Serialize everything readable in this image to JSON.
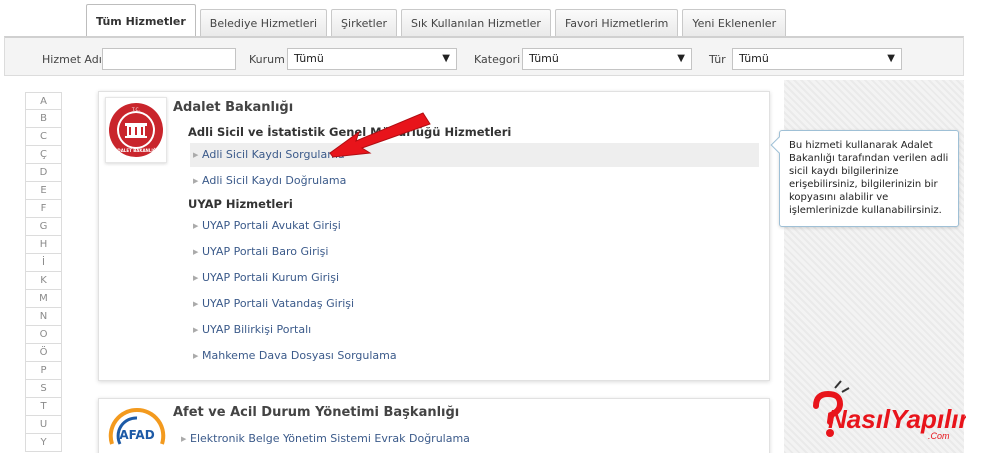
{
  "tabs": [
    {
      "label": "Tüm Hizmetler",
      "active": true
    },
    {
      "label": "Belediye Hizmetleri",
      "active": false
    },
    {
      "label": "Şirketler",
      "active": false
    },
    {
      "label": "Sık Kullanılan Hizmetler",
      "active": false
    },
    {
      "label": "Favori Hizmetlerim",
      "active": false
    },
    {
      "label": "Yeni Eklenenler",
      "active": false
    }
  ],
  "filters": {
    "service_name_label": "Hizmet Adı",
    "service_name_value": "",
    "institution_label": "Kurum",
    "institution_value": "Tümü",
    "category_label": "Kategori",
    "category_value": "Tümü",
    "type_label": "Tür",
    "type_value": "Tümü"
  },
  "alphabet": [
    "A",
    "B",
    "C",
    "Ç",
    "D",
    "E",
    "F",
    "G",
    "H",
    "İ",
    "K",
    "M",
    "N",
    "O",
    "Ö",
    "P",
    "S",
    "T",
    "U",
    "Y"
  ],
  "institutions": [
    {
      "title": "Adalet Bakanlığı",
      "logo_text_top": "T.C.",
      "logo_text_bottom": "ADALET BAKANLIĞI",
      "groups": [
        {
          "title": "Adli Sicil ve İstatistik Genel Müdürlüğü Hizmetleri",
          "services": [
            "Adli Sicil Kaydı Sorgulama",
            "Adli Sicil Kaydı Doğrulama"
          ]
        },
        {
          "title": "UYAP Hizmetleri",
          "services": [
            "UYAP Portali Avukat Girişi",
            "UYAP Portali Baro Girişi",
            "UYAP Portali Kurum Girişi",
            "UYAP Portali Vatandaş Girişi",
            "UYAP Bilirkişi Portalı",
            "Mahkeme Dava Dosyası Sorgulama"
          ]
        }
      ]
    },
    {
      "title": "Afet ve Acil Durum Yönetimi Başkanlığı",
      "logo_text": "AFAD",
      "services": [
        "Elektronik Belge Yönetim Sistemi Evrak Doğrulama"
      ]
    }
  ],
  "tooltip": {
    "text": "Bu hizmeti kullanarak Adalet Bakanlığı tarafından verilen adli sicil kaydı bilgilerinize erişebilirsiniz, bilgilerinizin bir kopyasını alabilir ve işlemlerinizde kullanabilirsiniz."
  },
  "watermark": {
    "main": "NasılYapılır",
    "suffix": ".Com"
  },
  "colors": {
    "link": "#3b5a8a",
    "arrow": "#e8141b",
    "tooltip_border": "#9fc0d6"
  }
}
